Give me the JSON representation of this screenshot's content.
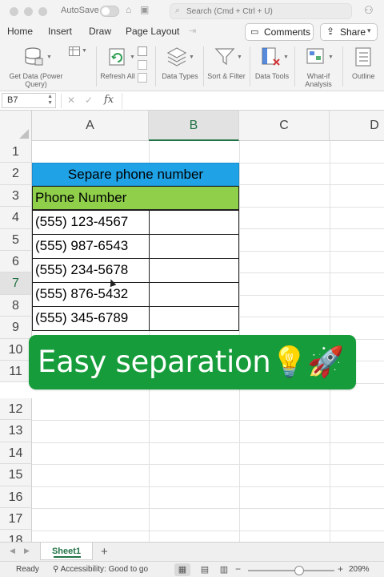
{
  "titlebar": {
    "autosave_label": "AutoSave",
    "search_placeholder": "Search (Cmd + Ctrl + U)"
  },
  "menu": {
    "tabs": [
      "Home",
      "Insert",
      "Draw",
      "Page Layout"
    ],
    "comments_label": "Comments",
    "share_label": "Share"
  },
  "ribbon": {
    "get_data_label": "Get Data (Power Query)",
    "refresh_label": "Refresh All",
    "data_types_label": "Data Types",
    "sort_filter_label": "Sort & Filter",
    "data_tools_label": "Data Tools",
    "what_if_label": "What-if Analysis",
    "outline_label": "Outline"
  },
  "formula_bar": {
    "name_box": "B7",
    "fx_label": "fx",
    "formula": ""
  },
  "grid": {
    "columns": [
      "A",
      "B",
      "C",
      "D"
    ],
    "selected_column": "B",
    "rows": [
      "1",
      "2",
      "3",
      "4",
      "5",
      "6",
      "7",
      "8",
      "9",
      "10",
      "11",
      "12",
      "13",
      "14",
      "15",
      "16",
      "17",
      "18"
    ],
    "selected_row": "7",
    "title_text": "Separe phone number",
    "header_text": "Phone Number",
    "phone_numbers": [
      "(555) 123-4567",
      "(555) 987-6543",
      "(555) 234-5678",
      "(555) 876-5432",
      "(555) 345-6789"
    ]
  },
  "overlay": {
    "caption": "Easy separation💡🚀"
  },
  "sheets": {
    "active": "Sheet1",
    "add_label": "+"
  },
  "status": {
    "ready": "Ready",
    "accessibility": "Accessibility: Good to go",
    "zoom": "209%"
  },
  "colors": {
    "title_fill": "#1fa2e6",
    "header_fill": "#8fcf4a",
    "banner_fill": "#169c3a",
    "excel_green": "#217346"
  }
}
